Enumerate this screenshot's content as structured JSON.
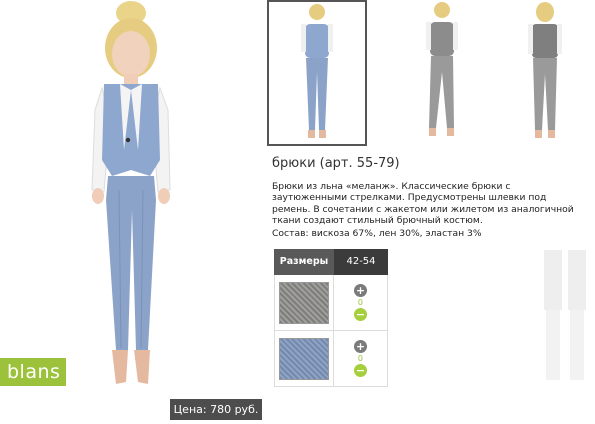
{
  "product": {
    "title": "брюки (арт. 55-79)",
    "description": "Брюки из льна «меланж». Классические брюки с заутюженными стрелками. Предусмотрены шлевки под ремень. В сочетании с жакетом или жилетом из аналогичной ткани создают стильный брючный костюм.",
    "composition": "Состав: вискоза 67%, лен 30%, эластан 3%",
    "price": "Цена: 780 руб."
  },
  "brand": {
    "label": "blans",
    "color": "#9cc23c"
  },
  "thumbnails": [
    {
      "id": "thumb-1",
      "active": true,
      "color": "#8ea4c6"
    },
    {
      "id": "thumb-2",
      "active": false,
      "color": "#8c8c8c"
    },
    {
      "id": "thumb-3",
      "active": false,
      "color": "#8c8c8c"
    }
  ],
  "size_table": {
    "header_label": "Размеры",
    "size": "42-54",
    "rows": [
      {
        "swatch_name": "grey-melange",
        "swatch_color": "#8a8a88",
        "qty": "0"
      },
      {
        "swatch_name": "blue-melange",
        "swatch_color": "#7e92b4",
        "qty": "0"
      }
    ]
  },
  "icons": {
    "plus": "plus-icon",
    "minus": "minus-icon"
  },
  "glyphs": {
    "plus": "+",
    "minus": "−"
  }
}
